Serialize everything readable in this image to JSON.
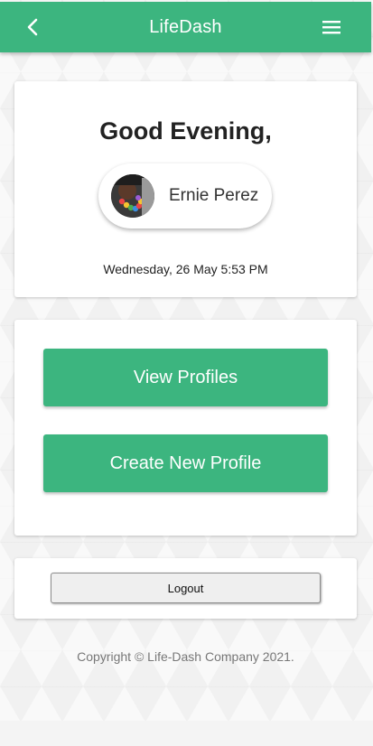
{
  "app_bar": {
    "title": "LifeDash",
    "back_icon": "chevron-left-icon",
    "menu_icon": "hamburger-menu-icon",
    "color": "#3cb57f"
  },
  "greeting_card": {
    "greeting": "Good Evening,",
    "user_name": "Ernie Perez",
    "avatar_icon": "user-avatar",
    "datetime": "Wednesday, 26 May 5:53 PM"
  },
  "actions": {
    "view_profiles_label": "View Profiles",
    "create_profile_label": "Create New Profile"
  },
  "logout": {
    "label": "Logout"
  },
  "footer": {
    "copyright": "Copyright © Life-Dash Company 2021."
  }
}
